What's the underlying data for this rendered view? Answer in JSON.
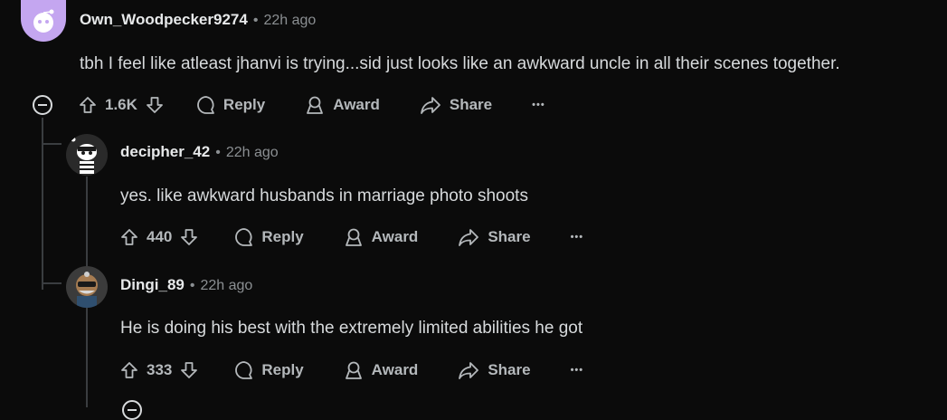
{
  "comments": [
    {
      "username": "Own_Woodpecker9274",
      "separator": "•",
      "time": "22h ago",
      "text": "tbh I feel like atleast jhanvi is trying...sid just looks like an awkward uncle in all their scenes together.",
      "votes": "1.6K",
      "reply_label": "Reply",
      "award_label": "Award",
      "share_label": "Share",
      "more_label": "•••"
    },
    {
      "username": "decipher_42",
      "separator": "•",
      "time": "22h ago",
      "text": "yes. like awkward husbands in marriage photo shoots",
      "votes": "440",
      "reply_label": "Reply",
      "award_label": "Award",
      "share_label": "Share",
      "more_label": "•••"
    },
    {
      "username": "Dingi_89",
      "separator": "•",
      "time": "22h ago",
      "text": "He is doing his best with the extremely limited abilities he got",
      "votes": "333",
      "reply_label": "Reply",
      "award_label": "Award",
      "share_label": "Share",
      "more_label": "•••"
    }
  ],
  "colors": {
    "background": "#0b0b0b",
    "text": "#d7dadc",
    "muted": "#8b8f92",
    "avatar_purple": "#c4a6f0"
  }
}
